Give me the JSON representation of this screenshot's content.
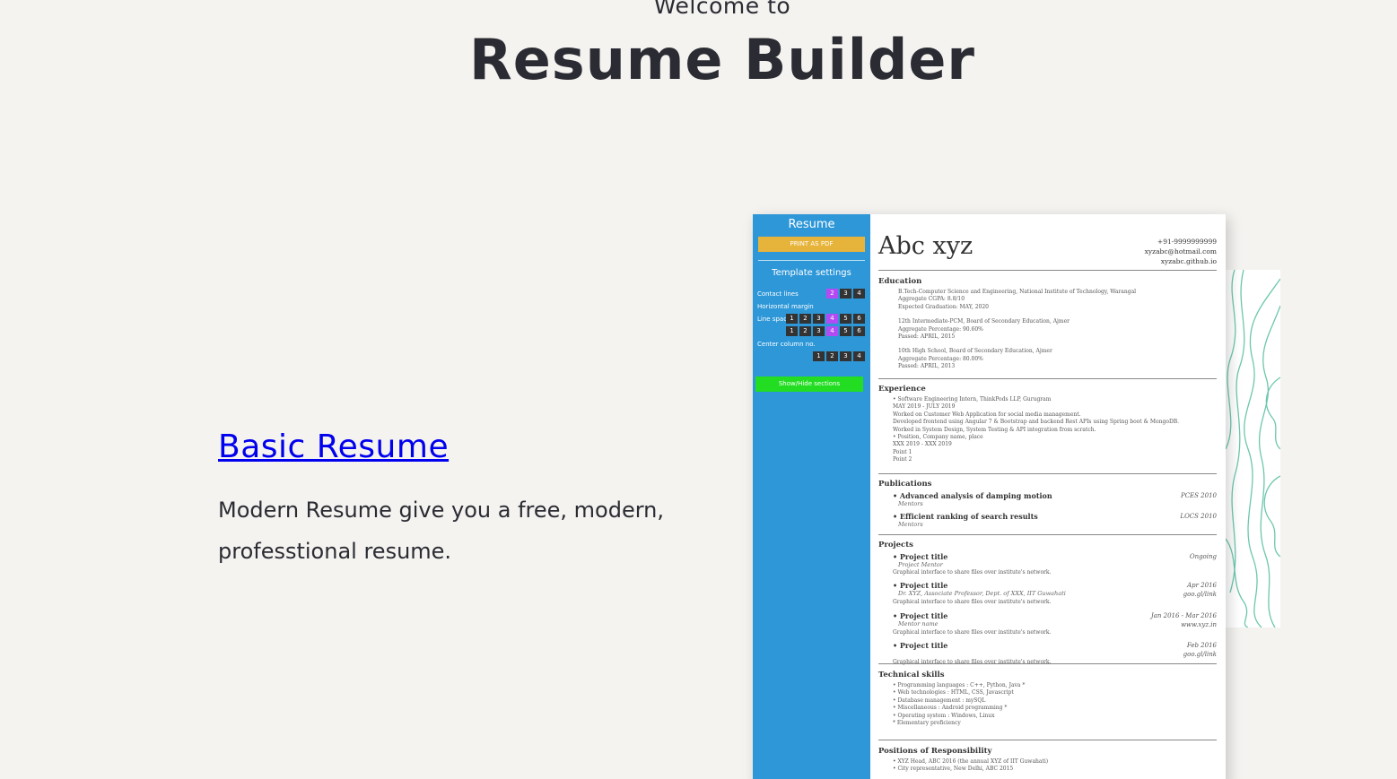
{
  "header": {
    "welcome": "Welcome to",
    "title": "Resume Builder"
  },
  "card": {
    "link": "Basic Resume",
    "description": "Modern Resume give you a free, modern, professtional resume."
  },
  "preview": {
    "sidebar": {
      "title": "Resume",
      "print": "PRINT AS PDF",
      "settings_title": "Template settings",
      "rows": [
        {
          "label": "Contact lines",
          "options": [
            "2",
            "3",
            "4"
          ],
          "selected": "2"
        },
        {
          "label": "Horizontal margin",
          "options": [],
          "selected": ""
        },
        {
          "label": "Line spacing",
          "options": [
            "1",
            "2",
            "3",
            "4",
            "5",
            "6"
          ],
          "selected": "4"
        },
        {
          "label": "",
          "options": [
            "1",
            "2",
            "3",
            "4",
            "5",
            "6"
          ],
          "selected": "4"
        },
        {
          "label": "Center column no.",
          "options": [],
          "selected": ""
        },
        {
          "label": "",
          "options": [
            "1",
            "2",
            "3",
            "4"
          ],
          "selected": ""
        }
      ],
      "green": "Show/Hide sections"
    },
    "name": "Abc xyz",
    "contact": [
      "+91-9999999999",
      "xyzabc@hotmail.com",
      "xyzabc.github.io"
    ],
    "education": {
      "title": "Education",
      "lines": [
        "B.Tech-Computer Science and Engineering, National Institute of Technology, Warangal",
        "Aggregate CGPA: 8.8/10",
        "Expected Graduation: MAY, 2020",
        "",
        "12th Intermediate-PCM, Board of Secondary Education, Ajmer",
        "Aggregate Percentage: 90.60%",
        "Passed: APRIL, 2015",
        "",
        "10th High School, Board of Secondary Education, Ajmer",
        "Aggregate Percentage: 80.00%",
        "Passed: APRIL, 2013"
      ]
    },
    "experience": {
      "title": "Experience",
      "lines": [
        "• Software Engineering Intern, ThinkPods LLP, Gurugram",
        "MAY 2019 - JULY 2019",
        "Worked on Customer Web Application for social media management.",
        "Developed frontend using Angular 7 & Bootstrap and backend Rest APIs using Spring boot & MongoDB.",
        "Worked in System Design, System Testing & API integration from scratch.",
        "• Position, Company name, place",
        "XXX 2019 - XXX 2019",
        "Point 1",
        "Point 2"
      ]
    },
    "publications": {
      "title": "Publications",
      "items": [
        {
          "name": "• Advanced analysis of damping motion",
          "right": "PCES 2010",
          "sub": "Mentors"
        },
        {
          "name": "• Efficient ranking of search results",
          "right": "LOCS 2010",
          "sub": "Mentors"
        }
      ]
    },
    "projects": {
      "title": "Projects",
      "items": [
        {
          "name": "• Project title",
          "right": "Ongoing",
          "sub": "Project Mentor",
          "right2": "",
          "desc": "Graphical interface to share files over institute's network."
        },
        {
          "name": "• Project title",
          "right": "Apr 2016",
          "sub": "Dr. XYZ, Associate Professor, Dept. of XXX, IIT Guwahati",
          "right2": "goo.gl/link",
          "desc": "Graphical interface to share files over institute's network."
        },
        {
          "name": "• Project title",
          "right": "Jan 2016 - Mar 2016",
          "sub": "Mentor name",
          "right2": "www.xyz.in",
          "desc": "Graphical interface to share files over institute's network."
        },
        {
          "name": "• Project title",
          "right": "Feb 2016",
          "sub": "",
          "right2": "goo.gl/link",
          "desc": "Graphical interface to share files over institute's network."
        }
      ]
    },
    "skills": {
      "title": "Technical skills",
      "lines": [
        "• Programming languages : C++, Python, Java *",
        "• Web technologies : HTML, CSS, Javascript",
        "• Database management : mySQL",
        "• Miscellaneous : Android programming *",
        "• Operating system : Windows, Linux",
        "* Elementary proficiency"
      ]
    },
    "responsibility": {
      "title": "Positions of Responsibility",
      "lines": [
        "• XYZ Head, ABC 2016 (the annual XYZ of IIT Guwahati)",
        "• City representative, New Delhi, ABC 2015"
      ]
    }
  }
}
